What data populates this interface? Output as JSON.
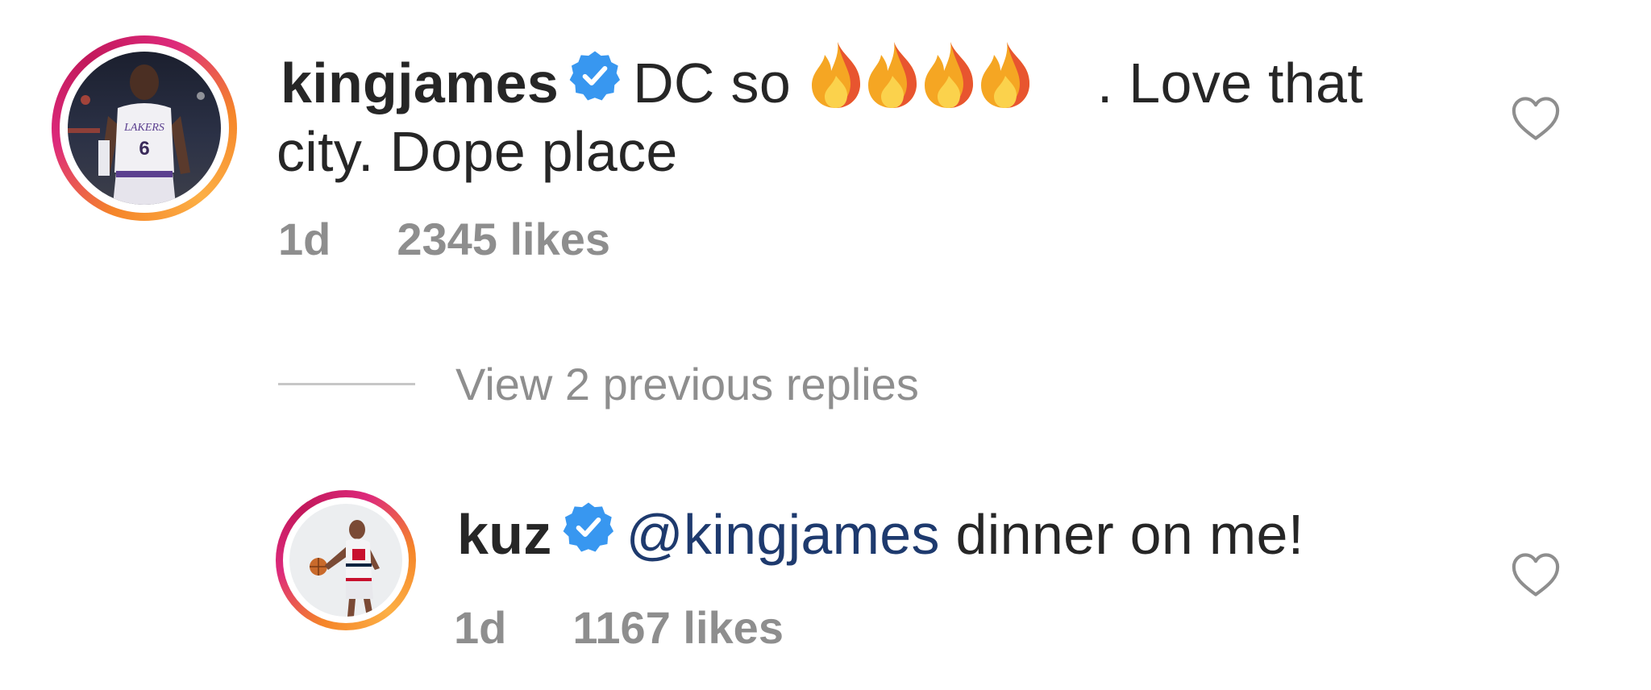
{
  "comments": [
    {
      "username": "kingjames",
      "verified": true,
      "text_before_emoji": "DC so",
      "emoji": "🔥🔥🔥🔥",
      "text_after_emoji": ". Love that",
      "text_line2": "city. Dope place",
      "age": "1d",
      "likes": "2345 likes",
      "icon_heart": "heart-outline-icon",
      "icon_verified": "verified-badge-icon"
    },
    {
      "username": "kuz",
      "verified": true,
      "mention": "@kingjames",
      "text": " dinner on me!",
      "age": "1d",
      "likes": "1167 likes",
      "icon_heart": "heart-outline-icon",
      "icon_verified": "verified-badge-icon"
    }
  ],
  "replies_toggle": {
    "label": "View 2 previous replies"
  },
  "colors": {
    "text": "#262626",
    "secondary": "#8e8e8e",
    "verified": "#3897f0",
    "mention": "#1e3a6e",
    "ring_start": "#f58529",
    "ring_end": "#dd2a7b"
  }
}
